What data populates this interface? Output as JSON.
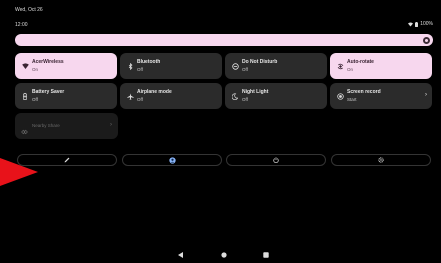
{
  "status_bar": {
    "date": "Wed, Oct 26",
    "time": "12:00",
    "battery": "100%",
    "icons": [
      "wifi-icon",
      "battery-icon"
    ]
  },
  "brightness": {
    "level": 1.0
  },
  "tiles": [
    {
      "title": "AcerWireless",
      "subtitle": "On",
      "icon": "wifi-icon",
      "active": true
    },
    {
      "title": "Bluetooth",
      "subtitle": "Off",
      "icon": "bluetooth-icon",
      "active": false
    },
    {
      "title": "Do Not Disturb",
      "subtitle": "Off",
      "icon": "do-not-disturb-icon",
      "active": false
    },
    {
      "title": "Auto-rotate",
      "subtitle": "On",
      "icon": "auto-rotate-icon",
      "active": true
    },
    {
      "title": "Battery Saver",
      "subtitle": "Off",
      "icon": "battery-saver-icon",
      "active": false
    },
    {
      "title": "Airplane mode",
      "subtitle": "Off",
      "icon": "airplane-icon",
      "active": false
    },
    {
      "title": "Night Light",
      "subtitle": "Off",
      "icon": "night-light-icon",
      "active": false
    },
    {
      "title": "Screen record",
      "subtitle": "Start",
      "icon": "screen-record-icon",
      "active": false
    }
  ],
  "nearby_share": {
    "label": "Nearby Share",
    "icon": "nearby-share-icon",
    "enabled": false
  },
  "actions": [
    "edit-icon",
    "user-icon",
    "power-icon",
    "settings-icon"
  ],
  "nav_bar": [
    "back-icon",
    "home-icon",
    "recents-icon"
  ],
  "annotation": {
    "type": "arrow",
    "color": "#e8121a"
  },
  "colors": {
    "active_tile": "#f7d7ee",
    "inactive_tile": "#2b2b2b",
    "background": "#000000",
    "accent_user": "#8ab4f8"
  }
}
